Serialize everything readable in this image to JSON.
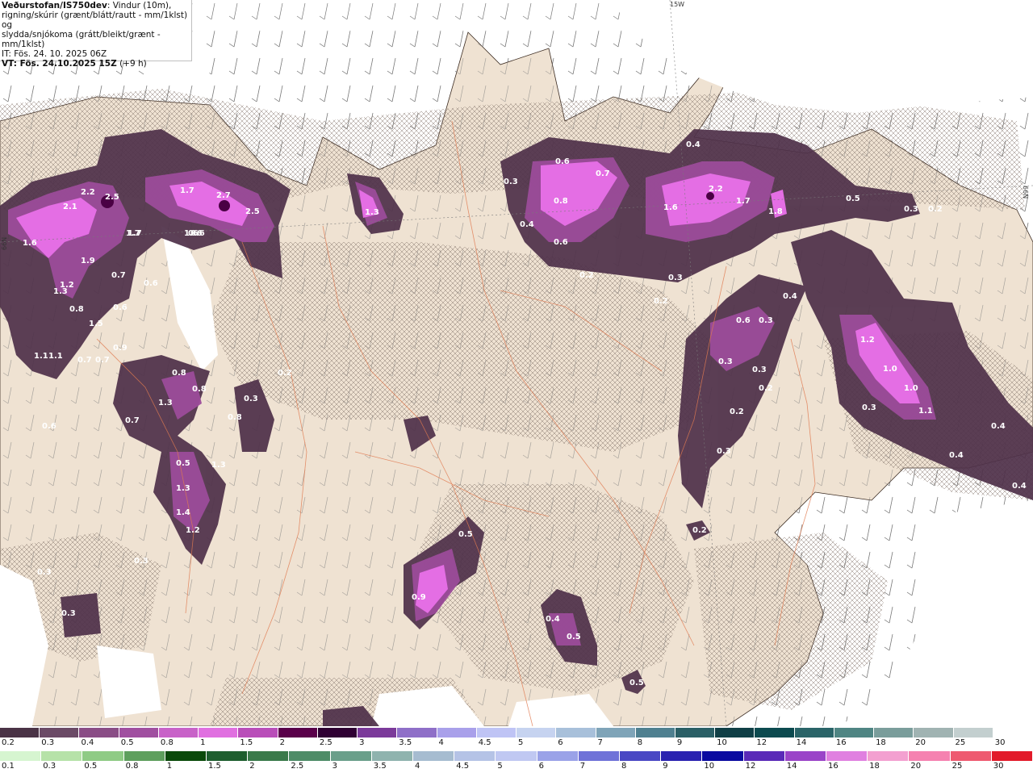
{
  "header": {
    "brand": "Veðurstofan/IS750dev",
    "line1_rest": ": Vindur (10m),",
    "line2": "rigning/skúrir (grænt/blátt/rautt - mm/1klst) og",
    "line3": "slydda/snjókoma (grátt/bleikt/grænt - mm/1klst)",
    "init_time": "IT: Fös. 24. 10. 2025 06Z",
    "valid_time": "VT: Fös. 24.10.2025 15Z",
    "lead": "(+9 h)"
  },
  "map": {
    "grid_labels": [
      "15W",
      "66N",
      "66N"
    ],
    "precip_labels": [
      "2.2",
      "2.5",
      "2.1",
      "1.7",
      "2.7",
      "2.5",
      "1.6",
      "1.9",
      "1.2",
      "1.3",
      "0.8",
      "0.7",
      "1.5",
      "0.6",
      "1.7",
      "0.6",
      "0.9",
      "1.1",
      "0.7",
      "0.7",
      "0.8",
      "0.8",
      "1.3",
      "0.3",
      "0.8",
      "0.7",
      "0.6",
      "0.5",
      "1.3",
      "1.3",
      "1.4",
      "1.2",
      "0.2",
      "0.3",
      "0.3",
      "0.2",
      "0.4",
      "0.6",
      "0.7",
      "0.3",
      "0.8",
      "0.4",
      "0.6",
      "0.2",
      "1.6",
      "2.2",
      "1.7",
      "1.8",
      "0.5",
      "0.3",
      "0.4",
      "0.3",
      "0.2",
      "0.4",
      "0.6",
      "0.3",
      "0.3",
      "0.2",
      "0.2",
      "0.3",
      "1.2",
      "1.0",
      "1.0",
      "0.3",
      "1.1",
      "0.4",
      "0.4",
      "0.3",
      "0.2",
      "0.5",
      "0.9",
      "0.4",
      "0.5",
      "0.5",
      "1.7",
      "1.6",
      "0.6",
      "1.3",
      "1.1",
      "0.3",
      "0.2",
      "0.6"
    ]
  },
  "legend_snow": {
    "labels": [
      "0.2",
      "0.3",
      "0.4",
      "0.5",
      "0.8",
      "1",
      "1.5",
      "2",
      "2.5",
      "3",
      "3.5",
      "4",
      "4.5",
      "5",
      "6",
      "7",
      "8",
      "9",
      "10",
      "12",
      "14",
      "16",
      "18",
      "20",
      "25",
      "30"
    ],
    "colors": [
      "#4a3346",
      "#6b4a66",
      "#8a4d86",
      "#a04fa0",
      "#c862c8",
      "#e070e0",
      "#b94eb9",
      "#5a004a",
      "#2f0033",
      "#7b3a9a",
      "#8f6fc8",
      "#a9a0ea",
      "#bfc4f5",
      "#c6d3f0",
      "#a8c0da",
      "#7fa4b8",
      "#4f8090",
      "#2a5f66",
      "#103f46",
      "#0c4a4f",
      "#2a6468",
      "#4f8583",
      "#7a9d9b",
      "#a0b3b2",
      "#c3cfcf",
      "#ffffff"
    ]
  },
  "legend_rain": {
    "labels": [
      "0.1",
      "0.3",
      "0.5",
      "0.8",
      "1",
      "1.5",
      "2",
      "2.5",
      "3",
      "3.5",
      "4",
      "4.5",
      "5",
      "6",
      "7",
      "8",
      "9",
      "10",
      "12",
      "14",
      "16",
      "18",
      "20",
      "25",
      "30"
    ],
    "colors": [
      "#d6f5d0",
      "#b6e2a8",
      "#8fcb85",
      "#5e9f5d",
      "#0a4a0a",
      "#1e5e2e",
      "#3a7a4a",
      "#4e8c67",
      "#6a9f8a",
      "#8fb3ae",
      "#a6bcd0",
      "#b5c3e6",
      "#c0c8f2",
      "#9aa2e8",
      "#6f72d8",
      "#4a48c4",
      "#2a22b0",
      "#0a0aa0",
      "#5a2ab8",
      "#9a44c8",
      "#e080e0",
      "#f3a0d0",
      "#f582b0",
      "#ee5a70",
      "#e21a2a"
    ]
  }
}
